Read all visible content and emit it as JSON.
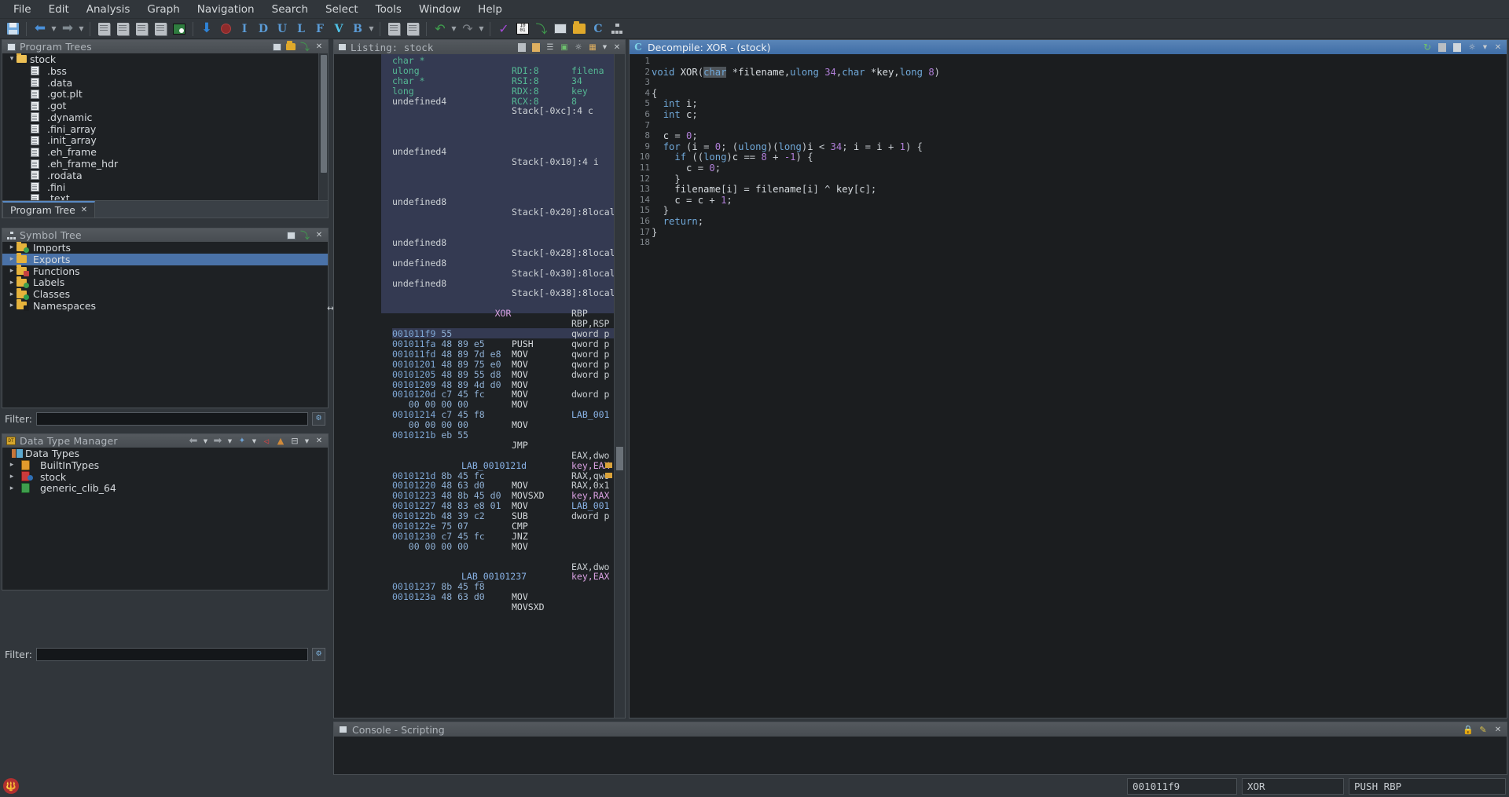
{
  "menubar": {
    "items": [
      "File",
      "Edit",
      "Analysis",
      "Graph",
      "Navigation",
      "Search",
      "Select",
      "Tools",
      "Window",
      "Help"
    ]
  },
  "toolbar": {
    "icons": [
      "save-icon",
      "back-arrow-icon",
      "back-dropdown-icon",
      "forward-arrow-icon",
      "forward-dropdown-icon",
      "snapshot-icon",
      "snapshot2-icon",
      "snapshot3-icon",
      "snapshot4-icon",
      "memory-map-icon",
      "down-arrow-icon",
      "stop-icon",
      "instruction-icon",
      "data-icon",
      "undefine-icon",
      "label-icon",
      "function-icon",
      "view-icon",
      "bookmark-icon",
      "bookmark-dropdown-icon",
      "diff-icon",
      "diff2-icon",
      "undo-icon",
      "undo-dropdown-icon",
      "redo-icon",
      "redo-dropdown-icon",
      "checkmark-icon",
      "byte-viewer-icon",
      "export-icon",
      "table-icon",
      "data-type-icon",
      "c-parser-icon",
      "tree-icon"
    ],
    "letters": {
      "i": "I",
      "d": "D",
      "u": "U",
      "l": "L",
      "f": "F",
      "v": "V",
      "b": "B"
    }
  },
  "programTrees": {
    "title": "Program Trees",
    "titleButtons": [
      "new-tree-icon",
      "open-folder-icon",
      "paste-icon",
      "close-icon"
    ],
    "root": "stock",
    "sections": [
      ".bss",
      ".data",
      ".got.plt",
      ".got",
      ".dynamic",
      ".fini_array",
      ".init_array",
      ".eh_frame",
      ".eh_frame_hdr",
      ".rodata",
      ".fini",
      ".text"
    ],
    "tab": "Program Tree",
    "tabClose": "✕"
  },
  "symbolTree": {
    "title": "Symbol Tree",
    "titleButtons": [
      "snapshot-icon",
      "paste-icon",
      "close-icon"
    ],
    "items": [
      {
        "label": "Imports",
        "selected": false,
        "badge": "#3f9e4d"
      },
      {
        "label": "Exports",
        "selected": true,
        "badge": ""
      },
      {
        "label": "Functions",
        "selected": false,
        "badge": "#c44040"
      },
      {
        "label": "Labels",
        "selected": false,
        "badge": "#3f9e4d"
      },
      {
        "label": "Classes",
        "selected": false,
        "badge": "#2e9e4f"
      },
      {
        "label": "Namespaces",
        "selected": false,
        "badge": "#222222"
      }
    ],
    "filterLabel": "Filter:",
    "filterValue": "",
    "filterPlaceholder": ""
  },
  "dataTypeManager": {
    "title": "Data Type Manager",
    "titleButtons": [
      "back-arrow-icon",
      "back-dropdown-icon",
      "forward-arrow-icon",
      "forward-dropdown-icon",
      "filter-icon",
      "filter-dropdown-icon",
      "disabled-filter-icon",
      "conflict-icon",
      "collapse-icon",
      "collapse-dropdown-icon",
      "close-icon"
    ],
    "rootLabel": "Data Types",
    "items": [
      {
        "label": "BuiltInTypes",
        "color": "#e09a2c"
      },
      {
        "label": "stock",
        "color": "#cc3b3b"
      },
      {
        "label": "generic_clib_64",
        "color": "#3f9e4d"
      }
    ],
    "filterLabel": "Filter:",
    "filterValue": ""
  },
  "listing": {
    "title": "Listing:  stock",
    "titleIcons": [
      "listing-icon",
      "copy-icon",
      "paste-icon",
      "header-icon",
      "diff-icon",
      "snapshot-icon",
      "toggle-icon",
      "dropdown-icon",
      "close-icon"
    ],
    "header_rows": [
      {
        "type": "param",
        "typ": "char *",
        "reg": "RDI:8",
        "name": "filena"
      },
      {
        "type": "param",
        "typ": "ulong",
        "reg": "RSI:8",
        "name": "34"
      },
      {
        "type": "param",
        "typ": "char *",
        "reg": "RDX:8",
        "name": "key"
      },
      {
        "type": "param",
        "typ": "long",
        "reg": "RCX:8",
        "name": "8"
      },
      {
        "type": "local",
        "typ": "undefined4",
        "reg": "Stack[-0xc]:4",
        "name": "c"
      },
      {
        "type": "blank"
      },
      {
        "type": "blank"
      },
      {
        "type": "blank"
      },
      {
        "type": "local",
        "typ": "undefined4",
        "reg": "Stack[-0x10]:4",
        "name": "i"
      },
      {
        "type": "blank"
      },
      {
        "type": "blank"
      },
      {
        "type": "blank"
      },
      {
        "type": "blank"
      },
      {
        "type": "local",
        "typ": "undefined8",
        "reg": "Stack[-0x20]:8",
        "name": "local_"
      },
      {
        "type": "blank"
      },
      {
        "type": "blank"
      },
      {
        "type": "blank"
      },
      {
        "type": "local",
        "typ": "undefined8",
        "reg": "Stack[-0x28]:8",
        "name": "local_"
      },
      {
        "type": "blank"
      },
      {
        "type": "local",
        "typ": "undefined8",
        "reg": "Stack[-0x30]:8",
        "name": "local_"
      },
      {
        "type": "blank"
      },
      {
        "type": "local",
        "typ": "undefined8",
        "reg": "Stack[-0x38]:8",
        "name": "local_"
      },
      {
        "type": "blank"
      },
      {
        "type": "blank"
      },
      {
        "type": "funclabel",
        "name": "XOR"
      },
      {
        "type": "blank"
      }
    ],
    "instructions": [
      {
        "addr": "001011f9",
        "bytes": "55",
        "mnem": "PUSH",
        "op": "RBP",
        "current": true
      },
      {
        "addr": "001011fa",
        "bytes": "48 89 e5",
        "mnem": "MOV",
        "op": "RBP,RSP"
      },
      {
        "addr": "001011fd",
        "bytes": "48 89 7d e8",
        "mnem": "MOV",
        "op": "qword p"
      },
      {
        "addr": "00101201",
        "bytes": "48 89 75 e0",
        "mnem": "MOV",
        "op": "qword p"
      },
      {
        "addr": "00101205",
        "bytes": "48 89 55 d8",
        "mnem": "MOV",
        "op": "qword p"
      },
      {
        "addr": "00101209",
        "bytes": "48 89 4d d0",
        "mnem": "MOV",
        "op": "qword p"
      },
      {
        "addr": "0010120d",
        "bytes": "c7 45 fc",
        "mnem": "MOV",
        "op": "dword p"
      },
      {
        "addr": "",
        "bytes": "   00 00 00 00",
        "mnem": "",
        "op": ""
      },
      {
        "addr": "00101214",
        "bytes": "c7 45 f8",
        "mnem": "MOV",
        "op": "dword p"
      },
      {
        "addr": "",
        "bytes": "   00 00 00 00",
        "mnem": "",
        "op": ""
      },
      {
        "addr": "0010121b",
        "bytes": "eb 55",
        "mnem": "JMP",
        "op": "LAB_001"
      },
      {
        "type": "blank"
      },
      {
        "type": "blank"
      },
      {
        "type": "label",
        "name": "LAB_0010121d"
      },
      {
        "addr": "0010121d",
        "bytes": "8b 45 fc",
        "mnem": "MOV",
        "op": "EAX,dwo"
      },
      {
        "addr": "00101220",
        "bytes": "48 63 d0",
        "mnem": "MOVSXD",
        "op": "key,EAX",
        "opcolor": "key"
      },
      {
        "addr": "00101223",
        "bytes": "48 8b 45 d0",
        "mnem": "MOV",
        "op": "RAX,qwo"
      },
      {
        "addr": "00101227",
        "bytes": "48 83 e8 01",
        "mnem": "SUB",
        "op": "RAX,0x1"
      },
      {
        "addr": "0010122b",
        "bytes": "48 39 c2",
        "mnem": "CMP",
        "op": "key,RAX",
        "opcolor": "key"
      },
      {
        "addr": "0010122e",
        "bytes": "75 07",
        "mnem": "JNZ",
        "op": "LAB_001"
      },
      {
        "addr": "00101230",
        "bytes": "c7 45 fc",
        "mnem": "MOV",
        "op": "dword p"
      },
      {
        "addr": "",
        "bytes": "   00 00 00 00",
        "mnem": "",
        "op": ""
      },
      {
        "type": "blank"
      },
      {
        "type": "blank"
      },
      {
        "type": "label",
        "name": "LAB_00101237"
      },
      {
        "addr": "00101237",
        "bytes": "8b 45 f8",
        "mnem": "MOV",
        "op": "EAX,dwo"
      },
      {
        "addr": "0010123a",
        "bytes": "48 63 d0",
        "mnem": "MOVSXD",
        "op": "key,EAX",
        "opcolor": "key"
      }
    ]
  },
  "decompiler": {
    "title": "Decompile: XOR - (stock)",
    "titleIcons": [
      "refresh-icon",
      "copy-icon",
      "export-icon",
      "snapshot-icon",
      "menu-dropdown-icon",
      "close-icon"
    ],
    "highlight_token": "char",
    "lines": [
      {
        "n": "1",
        "code": ""
      },
      {
        "n": "2",
        "code": "void XOR(char *filename,ulong 34,char *key,long 8)"
      },
      {
        "n": "3",
        "code": ""
      },
      {
        "n": "4",
        "code": "{"
      },
      {
        "n": "5",
        "code": "  int i;"
      },
      {
        "n": "6",
        "code": "  int c;"
      },
      {
        "n": "7",
        "code": ""
      },
      {
        "n": "8",
        "code": "  c = 0;"
      },
      {
        "n": "9",
        "code": "  for (i = 0; (ulong)(long)i < 34; i = i + 1) {"
      },
      {
        "n": "10",
        "code": "    if ((long)c == 8 + -1) {"
      },
      {
        "n": "11",
        "code": "      c = 0;"
      },
      {
        "n": "12",
        "code": "    }"
      },
      {
        "n": "13",
        "code": "    filename[i] = filename[i] ^ key[c];"
      },
      {
        "n": "14",
        "code": "    c = c + 1;"
      },
      {
        "n": "15",
        "code": "  }"
      },
      {
        "n": "16",
        "code": "  return;"
      },
      {
        "n": "17",
        "code": "}"
      },
      {
        "n": "18",
        "code": ""
      }
    ]
  },
  "console": {
    "title": "Console - Scripting",
    "titleButtons": [
      "lock-icon",
      "edit-icon",
      "close-icon"
    ],
    "content": ""
  },
  "statusbar": {
    "address": "001011f9",
    "function": "XOR",
    "instruction": "PUSH RBP"
  },
  "colors": {
    "accent": "#4a72a8",
    "panelTitle": "#54595e",
    "background": "#31363b",
    "codeBackground": "#1e2124",
    "decompBackground": "#1b1d1f",
    "typeGreen": "#55b894",
    "addrBlue": "#7fa8d6",
    "keywordBlue": "#70a8d8",
    "numberPurple": "#b07fd8"
  }
}
